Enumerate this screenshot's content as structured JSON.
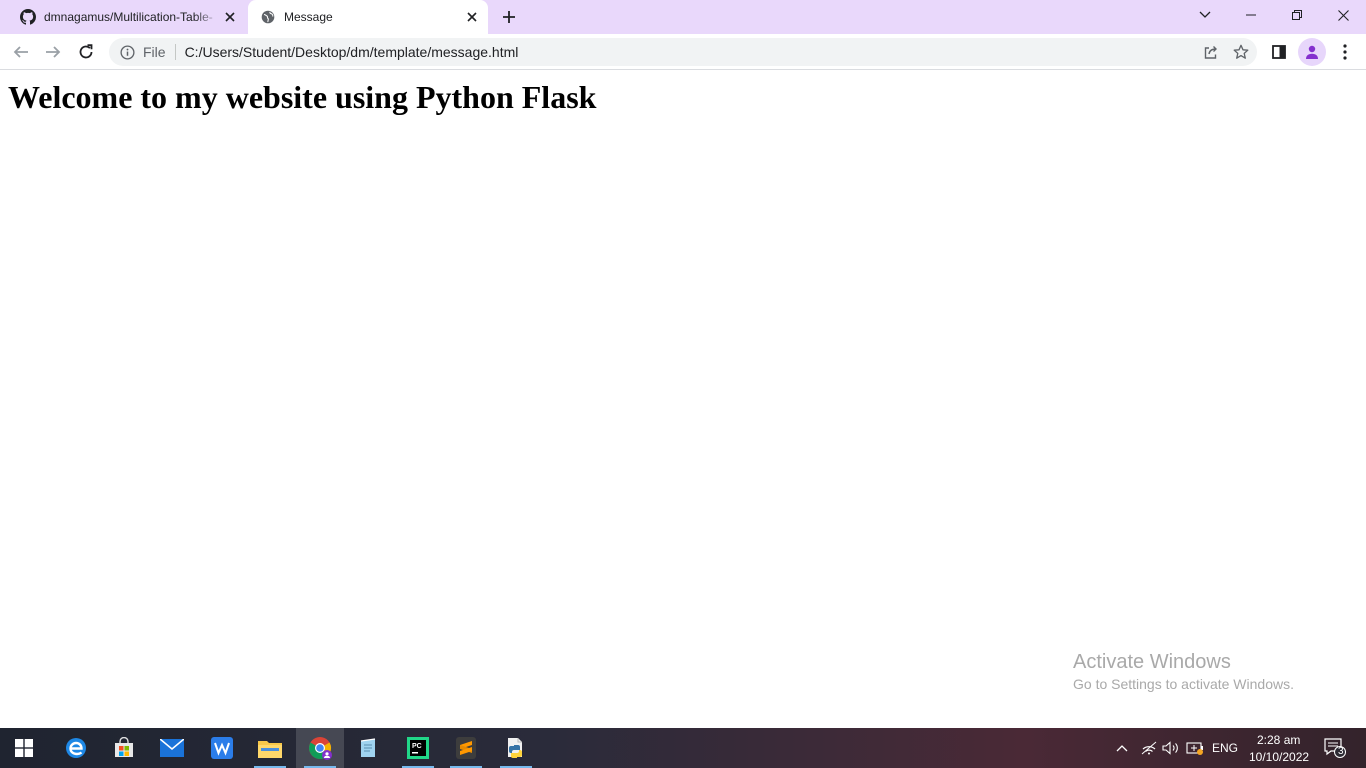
{
  "browser": {
    "tabs": [
      {
        "title": "dmnagamus/Multilication-Table-",
        "favicon": "github-icon",
        "active": false
      },
      {
        "title": "Message",
        "favicon": "globe-icon",
        "active": true
      }
    ],
    "address_bar": {
      "scheme_label": "File",
      "url": "C:/Users/Student/Desktop/dm/template/message.html"
    }
  },
  "page": {
    "heading": "Welcome to my website using Python Flask"
  },
  "watermark": {
    "title": "Activate Windows",
    "subtitle": "Go to Settings to activate Windows."
  },
  "taskbar": {
    "apps": [
      "start-icon",
      "edge-icon",
      "store-icon",
      "mail-icon",
      "wps-icon",
      "file-explorer-icon",
      "chrome-icon",
      "notepad-icon",
      "pycharm-icon",
      "sublime-icon",
      "python-icon"
    ],
    "language": "ENG",
    "time": "2:28 am",
    "date": "10/10/2022",
    "notification_count": "3"
  },
  "colors": {
    "tabstrip": "#e9d8fb",
    "taskbar_left": "#1f2430",
    "taskbar_right": "#4a2936",
    "profile_accent": "#8430ce"
  }
}
